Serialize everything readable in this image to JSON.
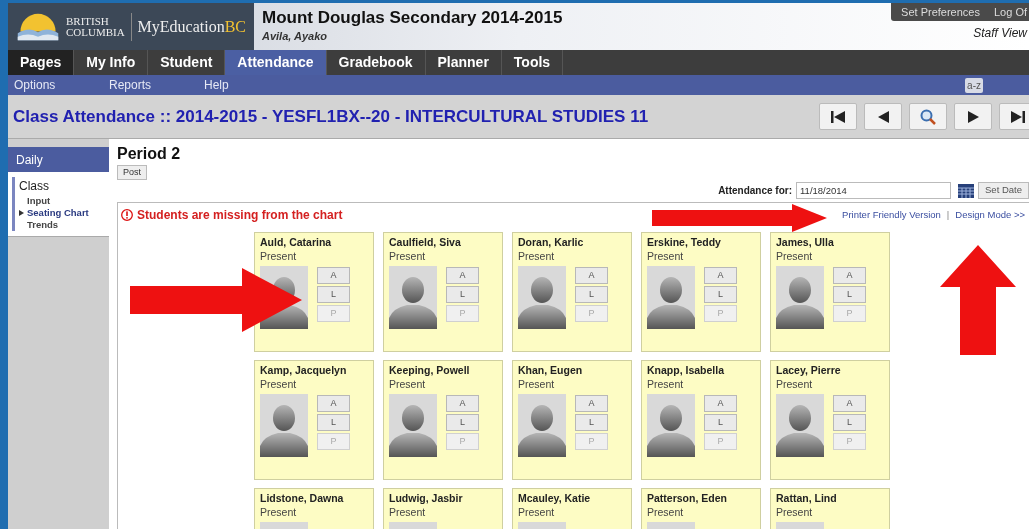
{
  "header": {
    "logo_top": "BRITISH",
    "logo_bottom": "COLUMBIA",
    "brand": {
      "name": "MyEducation",
      "suffix": "BC"
    },
    "school": "Mount Douglas Secondary 2014-2015",
    "user": "Avila, Ayako",
    "links": [
      "Set Preferences",
      "Log Of"
    ],
    "view": "Staff View"
  },
  "tabs": [
    {
      "label": "Pages",
      "selected": false
    },
    {
      "label": "My Info",
      "selected": false
    },
    {
      "label": "Student",
      "selected": false
    },
    {
      "label": "Attendance",
      "selected": true
    },
    {
      "label": "Gradebook",
      "selected": false
    },
    {
      "label": "Planner",
      "selected": false
    },
    {
      "label": "Tools",
      "selected": false
    }
  ],
  "menu": [
    "Options",
    "Reports",
    "Help"
  ],
  "sort_chip": "a-z",
  "page_title": "Class Attendance :: 2014-2015 - YESFL1BX--20 - INTERCULTURAL STUDIES 11",
  "sidebar": {
    "tab": "Daily",
    "section": "Class",
    "items": [
      {
        "label": "Input",
        "selected": false
      },
      {
        "label": "Seating Chart",
        "selected": true
      },
      {
        "label": "Trends",
        "selected": false
      }
    ]
  },
  "period": "Period 2",
  "post_button": "Post",
  "date_field": {
    "label": "Attendance for:",
    "value": "11/18/2014",
    "button": "Set Date"
  },
  "warning": "Students are missing from the chart",
  "chart_links": [
    "Printer Friendly Version",
    "Design Mode >>"
  ],
  "link_separator": "|",
  "students": [
    {
      "name": "Auld, Catarina",
      "status": "Present",
      "buttons": [
        {
          "label": "A",
          "disabled": false
        },
        {
          "label": "L",
          "disabled": false
        },
        {
          "label": "P",
          "disabled": true
        }
      ]
    },
    {
      "name": "Caulfield, Siva",
      "status": "Present",
      "buttons": [
        {
          "label": "A",
          "disabled": false
        },
        {
          "label": "L",
          "disabled": false
        },
        {
          "label": "P",
          "disabled": true
        }
      ]
    },
    {
      "name": "Doran, Karlic",
      "status": "Present",
      "buttons": [
        {
          "label": "A",
          "disabled": false
        },
        {
          "label": "L",
          "disabled": false
        },
        {
          "label": "P",
          "disabled": true
        }
      ]
    },
    {
      "name": "Erskine, Teddy",
      "status": "Present",
      "buttons": [
        {
          "label": "A",
          "disabled": false
        },
        {
          "label": "L",
          "disabled": false
        },
        {
          "label": "P",
          "disabled": true
        }
      ]
    },
    {
      "name": "James, Ulla",
      "status": "Present",
      "buttons": [
        {
          "label": "A",
          "disabled": false
        },
        {
          "label": "L",
          "disabled": false
        },
        {
          "label": "P",
          "disabled": true
        }
      ]
    },
    {
      "name": "Kamp, Jacquelyn",
      "status": "Present",
      "buttons": [
        {
          "label": "A",
          "disabled": false
        },
        {
          "label": "L",
          "disabled": false
        },
        {
          "label": "P",
          "disabled": true
        }
      ]
    },
    {
      "name": "Keeping, Powell",
      "status": "Present",
      "buttons": [
        {
          "label": "A",
          "disabled": false
        },
        {
          "label": "L",
          "disabled": false
        },
        {
          "label": "P",
          "disabled": true
        }
      ]
    },
    {
      "name": "Khan, Eugen",
      "status": "Present",
      "buttons": [
        {
          "label": "A",
          "disabled": false
        },
        {
          "label": "L",
          "disabled": false
        },
        {
          "label": "P",
          "disabled": true
        }
      ]
    },
    {
      "name": "Knapp, Isabella",
      "status": "Present",
      "buttons": [
        {
          "label": "A",
          "disabled": false
        },
        {
          "label": "L",
          "disabled": false
        },
        {
          "label": "P",
          "disabled": true
        }
      ]
    },
    {
      "name": "Lacey, Pierre",
      "status": "Present",
      "buttons": [
        {
          "label": "A",
          "disabled": false
        },
        {
          "label": "L",
          "disabled": false
        },
        {
          "label": "P",
          "disabled": true
        }
      ]
    },
    {
      "name": "Lidstone, Dawna",
      "status": "Present"
    },
    {
      "name": "Ludwig, Jasbir",
      "status": "Present"
    },
    {
      "name": "Mcauley, Katie",
      "status": "Present"
    },
    {
      "name": "Patterson, Eden",
      "status": "Present"
    },
    {
      "name": "Rattan, Lind",
      "status": "Present"
    }
  ]
}
